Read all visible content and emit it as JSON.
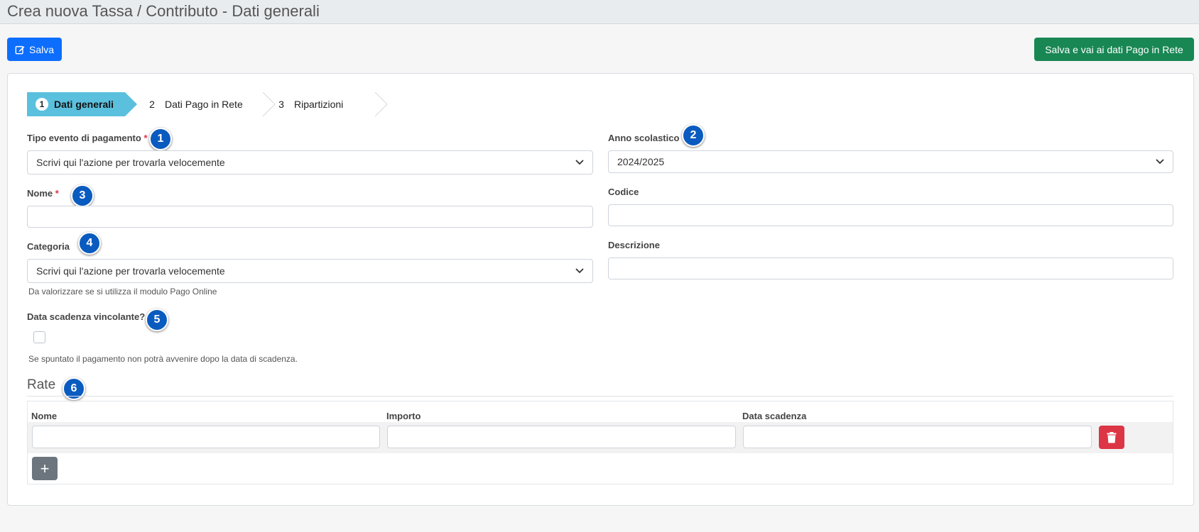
{
  "header": {
    "title": "Crea nuova Tassa / Contributo - Dati generali"
  },
  "toolbar": {
    "save_label": "Salva",
    "save_icon": "edit-icon",
    "next_label": "Salva e vai ai dati Pago in Rete"
  },
  "wizard": {
    "steps": [
      {
        "num": "1",
        "label": "Dati generali",
        "active": true
      },
      {
        "num": "2",
        "label": "Dati Pago in Rete",
        "active": false
      },
      {
        "num": "3",
        "label": "Ripartizioni",
        "active": false
      }
    ]
  },
  "form": {
    "tipo_evento": {
      "label": "Tipo evento di pagamento",
      "required_mark": "*",
      "value": "Scrivi qui l'azione per trovarla velocemente"
    },
    "anno_scolastico": {
      "label": "Anno scolastico",
      "value": "2024/2025"
    },
    "nome": {
      "label": "Nome",
      "required_mark": "*",
      "value": ""
    },
    "codice": {
      "label": "Codice",
      "value": ""
    },
    "categoria": {
      "label": "Categoria",
      "value": "Scrivi qui l'azione per trovarla velocemente",
      "help": "Da valorizzare se si utilizza il modulo Pago Online"
    },
    "descrizione": {
      "label": "Descrizione",
      "value": ""
    },
    "data_scadenza_vincolante": {
      "label": "Data scadenza vincolante?",
      "checked": false,
      "help": "Se spuntato il pagamento non potrà avvenire dopo la data di scadenza."
    }
  },
  "rate": {
    "title": "Rate",
    "columns": [
      "Nome",
      "Importo",
      "Data scadenza"
    ],
    "rows": [
      {
        "nome": "",
        "importo": "",
        "data_scadenza": ""
      }
    ],
    "delete_icon": "trash-icon",
    "add_label": "+"
  },
  "badges": [
    "1",
    "2",
    "3",
    "4",
    "5",
    "6"
  ],
  "colors": {
    "primary": "#0d6efd",
    "success": "#198754",
    "danger": "#dc3545",
    "wizard_active": "#5bc0de",
    "badge": "#0a5bbf",
    "secondary": "#6c757d"
  }
}
